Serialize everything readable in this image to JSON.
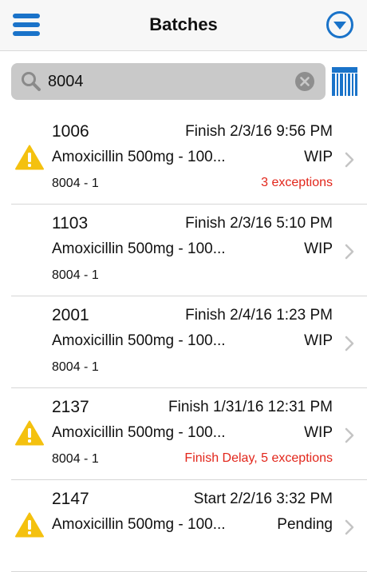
{
  "header": {
    "title": "Batches",
    "menu_icon": "hamburger-menu-icon",
    "filter_icon": "chevron-down-circle-icon"
  },
  "search": {
    "value": "8004",
    "search_icon": "search-icon",
    "clear_icon": "clear-circle-icon",
    "barcode_icon": "barcode-icon"
  },
  "colors": {
    "accent": "#1a73c9",
    "warning": "#f4c10f",
    "exception_text": "#e2261b"
  },
  "batches": [
    {
      "number": "1006",
      "time": "Finish 2/3/16 9:56 PM",
      "product": "Amoxicillin 500mg - 100...",
      "status": "WIP",
      "lot": "8004 - 1",
      "exceptions": "3 exceptions",
      "warning": true
    },
    {
      "number": "1103",
      "time": "Finish 2/3/16 5:10 PM",
      "product": "Amoxicillin 500mg - 100...",
      "status": "WIP",
      "lot": "8004 - 1",
      "exceptions": "",
      "warning": false
    },
    {
      "number": "2001",
      "time": "Finish 2/4/16 1:23 PM",
      "product": "Amoxicillin 500mg - 100...",
      "status": "WIP",
      "lot": "8004 - 1",
      "exceptions": "",
      "warning": false
    },
    {
      "number": "2137",
      "time": "Finish 1/31/16 12:31 PM",
      "product": "Amoxicillin 500mg - 100...",
      "status": "WIP",
      "lot": "8004 - 1",
      "exceptions": "Finish Delay, 5 exceptions",
      "warning": true
    },
    {
      "number": "2147",
      "time": "Start 2/2/16 3:32 PM",
      "product": "Amoxicillin 500mg - 100...",
      "status": "Pending",
      "lot": "",
      "exceptions": "",
      "warning": true
    }
  ]
}
